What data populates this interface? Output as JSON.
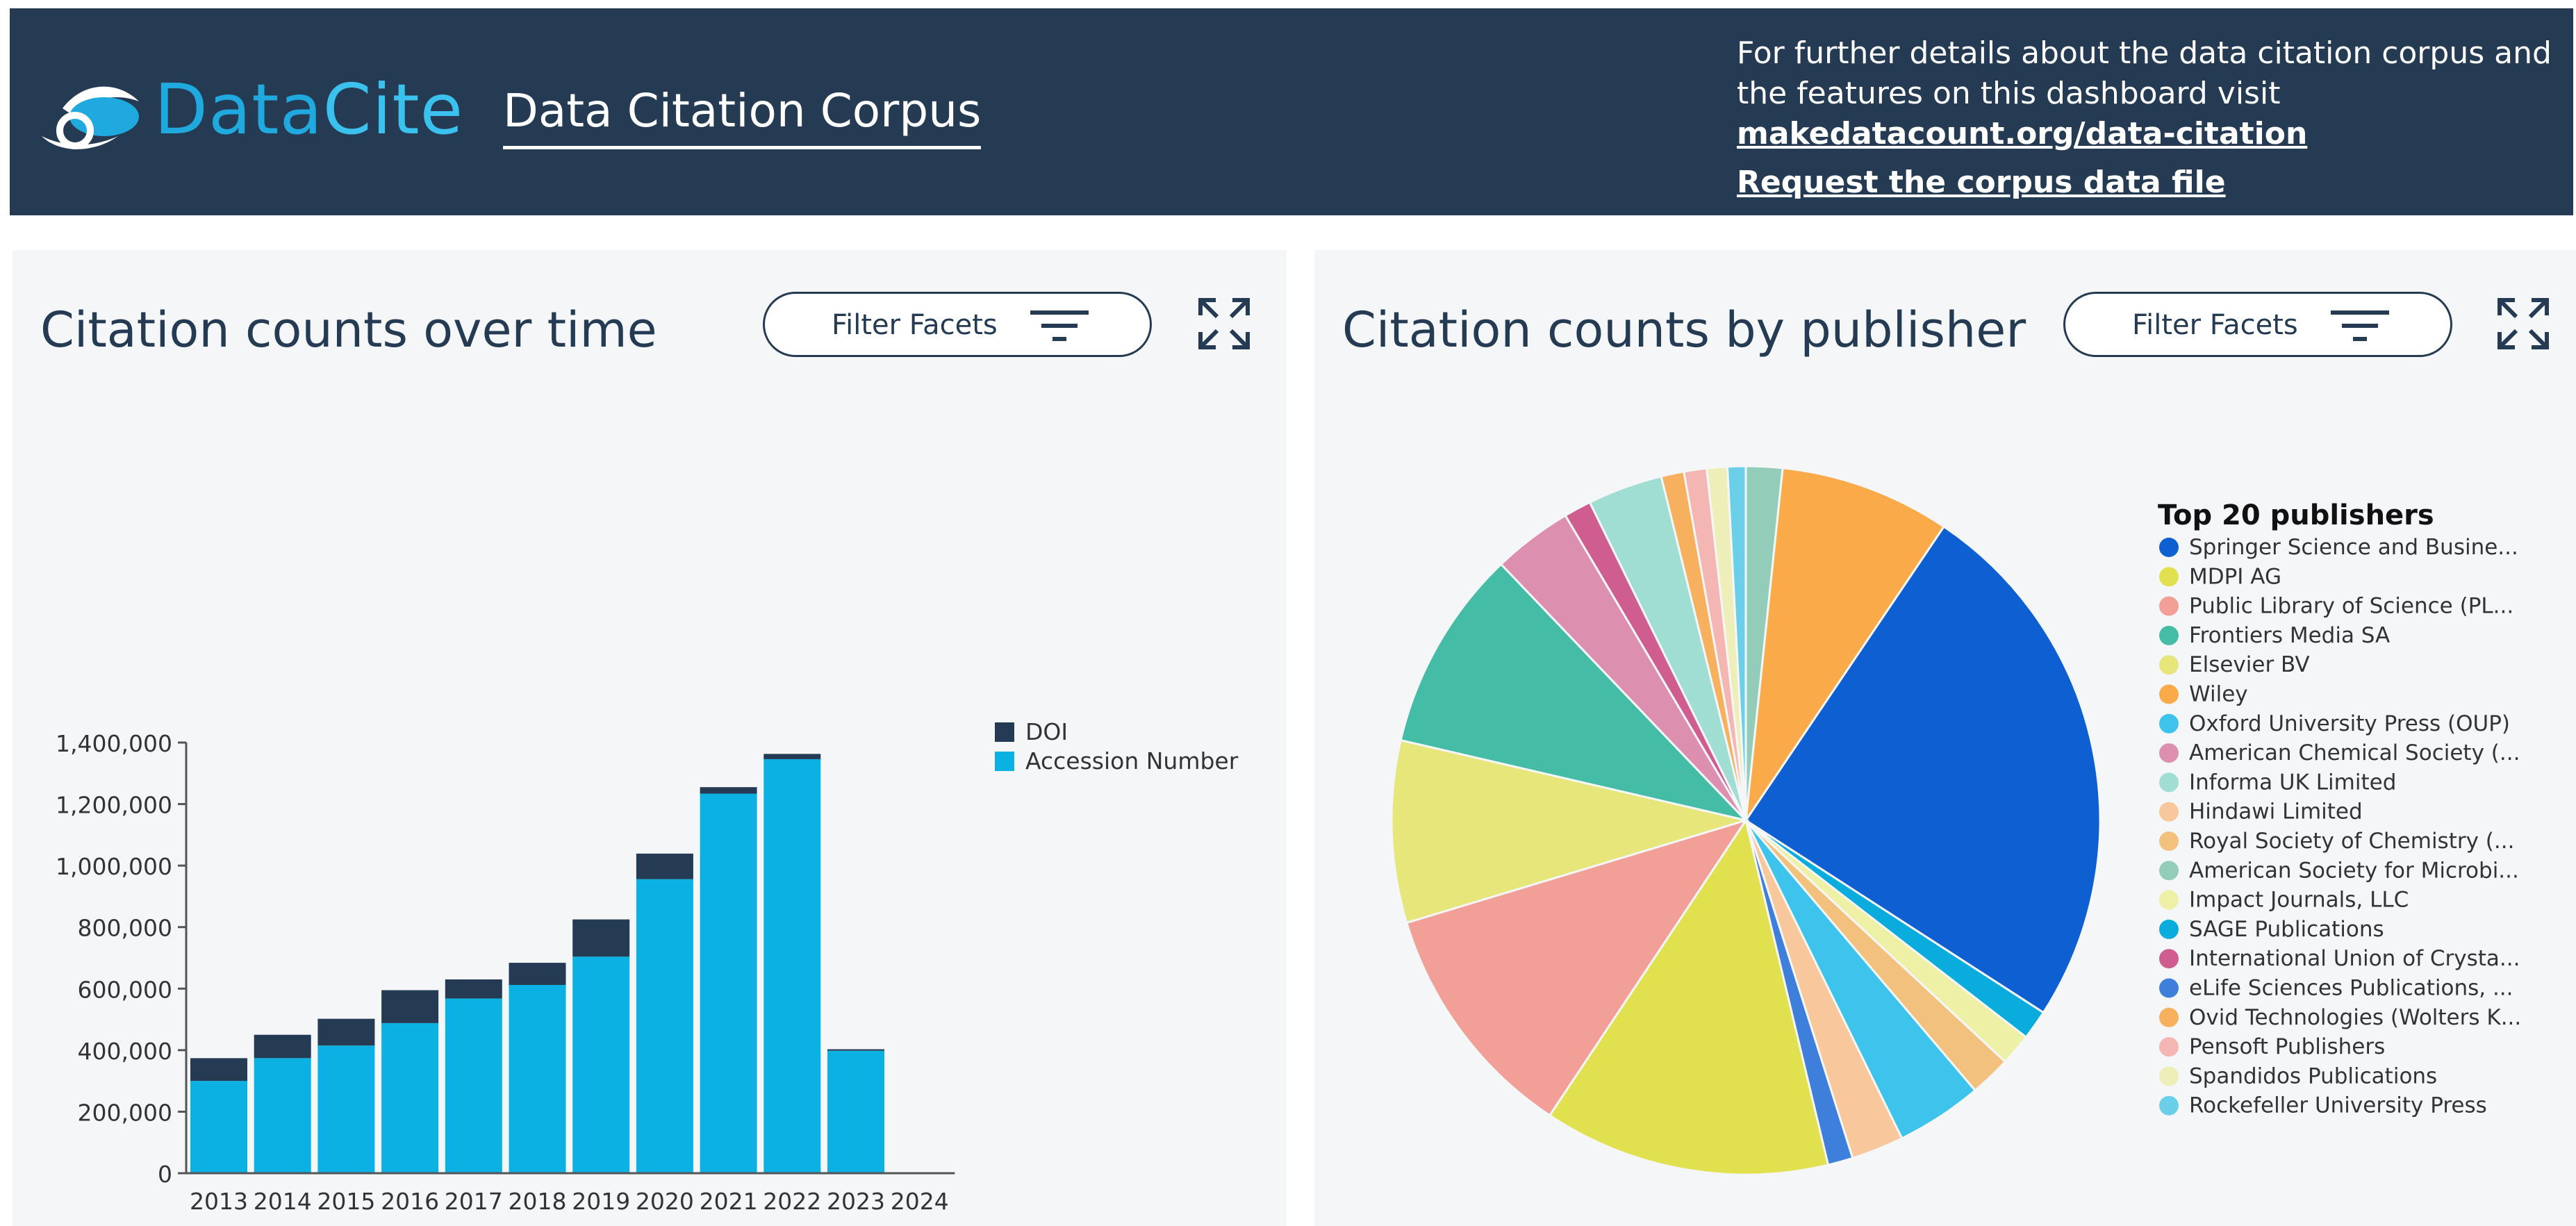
{
  "header": {
    "brand_part1": "Data",
    "brand_part2": "Cite",
    "app_title": "Data Citation Corpus",
    "info_text": "For further details about the data citation corpus and the features on this dashboard visit ",
    "info_link": "makedatacount.org/data-citation",
    "request_link": "Request the corpus data file"
  },
  "panels": {
    "left": {
      "title": "Citation counts over time",
      "filter_label": "Filter Facets"
    },
    "right": {
      "title": "Citation counts by publisher",
      "filter_label": "Filter Facets"
    }
  },
  "icons": {
    "logo": "datacite-logo-icon",
    "filter": "filter-lines-icon",
    "expand": "expand-arrows-icon"
  },
  "colors": {
    "header_bg": "#243b53",
    "doi": "#243b53",
    "accession": "#0bb1e3"
  },
  "chart_data": [
    {
      "type": "bar",
      "stacked": true,
      "categories": [
        "2013",
        "2014",
        "2015",
        "2016",
        "2017",
        "2018",
        "2019",
        "2020",
        "2021",
        "2022",
        "2023",
        "2024"
      ],
      "series": [
        {
          "name": "Accession Number",
          "color": "#0bb1e3",
          "values": [
            300000,
            374000,
            415000,
            488000,
            568000,
            612000,
            704000,
            956000,
            1234000,
            1346000,
            398000,
            0
          ]
        },
        {
          "name": "DOI",
          "color": "#243b53",
          "values": [
            74000,
            76000,
            87000,
            107000,
            62000,
            72000,
            121000,
            83000,
            21000,
            17000,
            5000,
            0
          ]
        }
      ],
      "yticks": [
        "0",
        "200,000",
        "400,000",
        "600,000",
        "800,000",
        "1,000,000",
        "1,200,000",
        "1,400,000"
      ],
      "ylim": [
        0,
        1400000
      ],
      "legend_order": [
        "DOI",
        "Accession Number"
      ],
      "legend_position": "top-right"
    },
    {
      "type": "pie",
      "legend_title": "Top 20 publishers",
      "legend_position": "right",
      "slices": [
        {
          "label": "Springer Science and Busine...",
          "color": "#0e5fd2",
          "value": 23.8
        },
        {
          "label": "MDPI AG",
          "color": "#e1e14f",
          "value": 12.6
        },
        {
          "label": "Public Library of Science (PL...",
          "color": "#f2a097",
          "value": 10.6
        },
        {
          "label": "Frontiers Media SA",
          "color": "#45bca6",
          "value": 8.9
        },
        {
          "label": "Elsevier BV",
          "color": "#e6e67a",
          "value": 8.0
        },
        {
          "label": "Wiley",
          "color": "#fbaa4a",
          "value": 7.5
        },
        {
          "label": "Oxford University Press (OUP)",
          "color": "#3ec3ec",
          "value": 3.8
        },
        {
          "label": "American Chemical Society (...",
          "color": "#dc8faf",
          "value": 3.5
        },
        {
          "label": "Informa UK Limited",
          "color": "#a0ddd2",
          "value": 3.3
        },
        {
          "label": "Hindawi Limited",
          "color": "#f8c79c",
          "value": 2.3
        },
        {
          "label": "Royal Society of Chemistry (...",
          "color": "#f2c17e",
          "value": 1.8
        },
        {
          "label": "American Society for Microbi...",
          "color": "#93ccb9",
          "value": 1.6
        },
        {
          "label": "Impact Journals, LLC",
          "color": "#eef0a5",
          "value": 1.4
        },
        {
          "label": "SAGE Publications",
          "color": "#0aabdd",
          "value": 1.3
        },
        {
          "label": "International Union of Crysta...",
          "color": "#cf5d90",
          "value": 1.2
        },
        {
          "label": "eLife Sciences Publications, ...",
          "color": "#3f7fdc",
          "value": 1.1
        },
        {
          "label": "Ovid Technologies (Wolters K...",
          "color": "#f6b05e",
          "value": 1.0
        },
        {
          "label": "Pensoft Publishers",
          "color": "#f4b6b3",
          "value": 1.0
        },
        {
          "label": "Spandidos Publications",
          "color": "#edeeb8",
          "value": 0.9
        },
        {
          "label": "Rockefeller University Press",
          "color": "#6ccfe9",
          "value": 0.8
        }
      ]
    }
  ]
}
